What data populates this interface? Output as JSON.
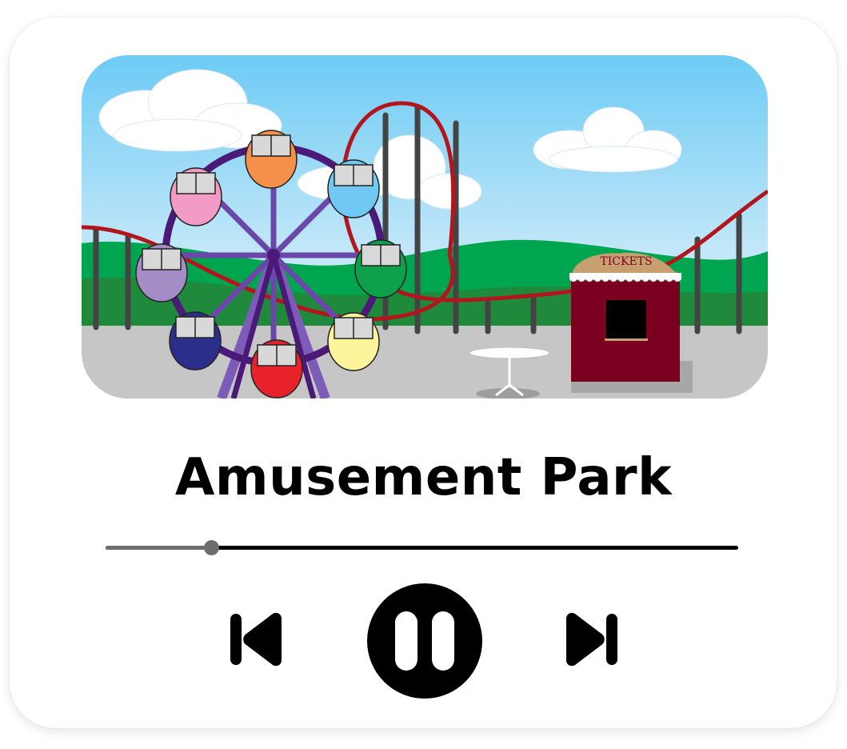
{
  "track": {
    "title": "Amusement Park",
    "progress_fraction": 0.167
  },
  "artwork": {
    "sign_text": "TICKETS",
    "colors": {
      "sky_top": "#6dcbf5",
      "sky_bottom": "#dff1fb",
      "hill": "#00a550",
      "ground": "#c6c6c6",
      "track": "#b3151c",
      "wheel": "#4b1978",
      "booth": "#7b0020",
      "booth_roof": "#c8a070"
    },
    "gondola_colors": [
      "#f5904a",
      "#6fc9f2",
      "#0ca14a",
      "#fdf49c",
      "#e8222a",
      "#2c2e8c",
      "#a48cc4",
      "#f29bc4"
    ]
  },
  "controls": {
    "previous_icon": "skip-previous-icon",
    "pause_icon": "pause-icon",
    "next_icon": "skip-next-icon"
  },
  "colors": {
    "accent": "#000000",
    "progress_played": "#6e6e6e",
    "progress_remaining": "#000000",
    "card_background": "#ffffff"
  }
}
